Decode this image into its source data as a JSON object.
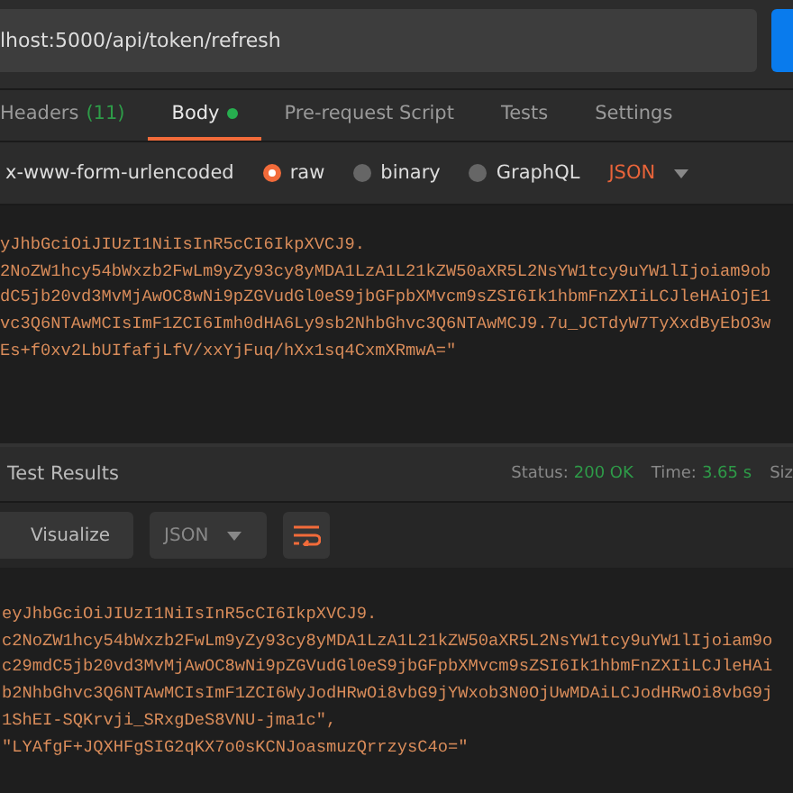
{
  "request": {
    "url": "lhost:5000/api/token/refresh"
  },
  "tabs": [
    {
      "label": "Headers",
      "count": "(11)",
      "dot": false,
      "selected": false
    },
    {
      "label": "Body",
      "dot": true,
      "selected": true
    },
    {
      "label": "Pre-request Script",
      "dot": false,
      "selected": false
    },
    {
      "label": "Tests",
      "dot": false,
      "selected": false
    },
    {
      "label": "Settings",
      "dot": false,
      "selected": false
    }
  ],
  "body_types": [
    {
      "label": "x-www-form-urlencoded",
      "kind": "plain",
      "selected": false
    },
    {
      "label": "raw",
      "kind": "radio",
      "selected": true
    },
    {
      "label": "binary",
      "kind": "radio",
      "selected": false
    },
    {
      "label": "GraphQL",
      "kind": "radio",
      "selected": false
    }
  ],
  "body_format": "JSON",
  "request_body": [
    "yJhbGciOiJIUzI1NiIsInR5cCI6IkpXVCJ9.",
    "2NoZW1hcy54bWxzb2FwLm9yZy93cy8yMDA1LzA1L21kZW50aXR5L2NsYW1tcy9uYW1lIjoiam9ob",
    "dC5jb20vd3MvMjAwOC8wNi9pZGVudGl0eS9jbGFpbXMvcm9sZSI6Ik1hbmFnZXIiLCJleHAiOjE1",
    "vc3Q6NTAwMCIsImF1ZCI6Imh0dHA6Ly9sb2NhbGhvc3Q6NTAwMCJ9.7u_JCTdyW7TyXxdByEbO3w",
    "Es+f0xv2LbUIfafjLfV/xxYjFuq/hXx1sq4CxmXRmwA=\""
  ],
  "response": {
    "tab": "Test Results",
    "status_label": "Status:",
    "status": "200 OK",
    "time_label": "Time:",
    "time": "3.65 s",
    "size_label": "Siz",
    "visualize": "Visualize",
    "format": "JSON",
    "lines": [
      "eyJhbGciOiJIUzI1NiIsInR5cCI6IkpXVCJ9.",
      "c2NoZW1hcy54bWxzb2FwLm9yZy93cy8yMDA1LzA1L21kZW50aXR5L2NsYW1tcy9uYW1lIjoiam9o",
      "c29mdC5jb20vd3MvMjAwOC8wNi9pZGVudGl0eS9jbGFpbXMvcm9sZSI6Ik1hbmFnZXIiLCJleHAi",
      "b2NhbGhvc3Q6NTAwMCIsImF1ZCI6WyJodHRwOi8vbG9jYWxob3N0OjUwMDAiLCJodHRwOi8vbG9j",
      "1ShEI-SQKrvji_SRxgDeS8VNU-jma1c\",",
      "\"LYAfgF+JQXHFgSIG2qKX7o0sKCNJoasmuzQrrzysC4o=\""
    ]
  }
}
